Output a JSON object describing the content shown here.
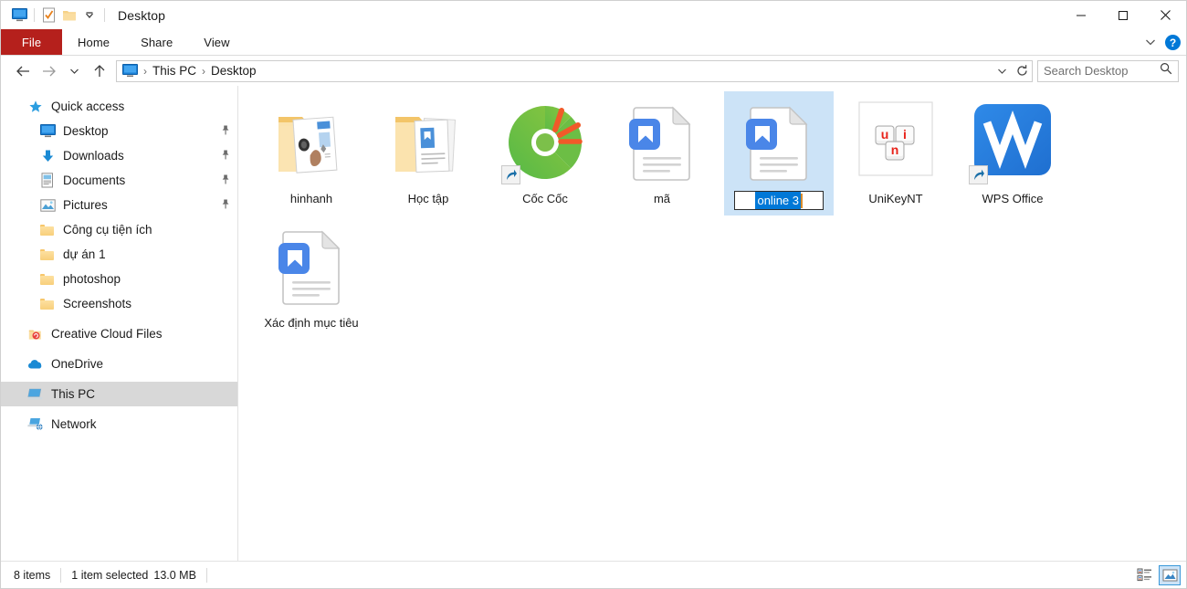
{
  "window": {
    "title": "Desktop",
    "quick_access_toolbar": [
      {
        "name": "explorer-icon",
        "icon": "monitor-icon"
      },
      {
        "name": "properties-icon",
        "icon": "checklist-icon"
      },
      {
        "name": "new-folder-icon",
        "icon": "folder-icon"
      },
      {
        "name": "customize-qat",
        "icon": "chevron-down-icon"
      }
    ],
    "caption": {
      "minimize": "–",
      "maximize": "☐",
      "close": "✕"
    }
  },
  "ribbon": {
    "file_tab": "File",
    "tabs": [
      "Home",
      "Share",
      "View"
    ],
    "file_tab_color": "#b5201c",
    "expand_label": "⌄",
    "help_label": "?"
  },
  "addressbar": {
    "back": "←",
    "forward": "→",
    "recent": "⌄",
    "up": "↑",
    "breadcrumbs": [
      "This PC",
      "Desktop"
    ],
    "separator": "›",
    "dropdown": "⌄",
    "refresh": "↻"
  },
  "search": {
    "placeholder": "Search Desktop",
    "icon": "search-icon"
  },
  "sidebar": {
    "groups": [
      {
        "header": {
          "label": "Quick access",
          "icon": "star-icon",
          "indent": 0
        },
        "items": [
          {
            "label": "Desktop",
            "icon": "monitor-icon",
            "pinned": true,
            "indent": 1
          },
          {
            "label": "Downloads",
            "icon": "download-icon",
            "pinned": true,
            "indent": 1
          },
          {
            "label": "Documents",
            "icon": "document-icon",
            "pinned": true,
            "indent": 1
          },
          {
            "label": "Pictures",
            "icon": "pictures-icon",
            "pinned": true,
            "indent": 1
          },
          {
            "label": "Công cụ tiện ích",
            "icon": "folder-icon",
            "pinned": false,
            "indent": 1
          },
          {
            "label": "dự án 1",
            "icon": "folder-icon",
            "pinned": false,
            "indent": 1
          },
          {
            "label": "photoshop",
            "icon": "folder-icon",
            "pinned": false,
            "indent": 1
          },
          {
            "label": "Screenshots",
            "icon": "folder-icon",
            "pinned": false,
            "indent": 1
          }
        ]
      }
    ],
    "roots": [
      {
        "label": "Creative Cloud Files",
        "icon": "creative-cloud-icon",
        "selected": false
      },
      {
        "label": "OneDrive",
        "icon": "cloud-icon",
        "selected": false
      },
      {
        "label": "This PC",
        "icon": "this-pc-icon",
        "selected": true
      },
      {
        "label": "Network",
        "icon": "network-icon",
        "selected": false
      }
    ]
  },
  "files": [
    {
      "name": "hinhanh",
      "icon": "folder-thumbnail-images",
      "selected": false,
      "shortcut": false,
      "renaming": false
    },
    {
      "name": "Học tập",
      "icon": "folder-thumbnail-docs",
      "selected": false,
      "shortcut": false,
      "renaming": false
    },
    {
      "name": "Cốc Cốc",
      "icon": "coccoc-icon",
      "selected": false,
      "shortcut": true,
      "renaming": false
    },
    {
      "name": "mã",
      "icon": "wps-writer-doc-icon",
      "selected": false,
      "shortcut": false,
      "renaming": false
    },
    {
      "name": "online 3",
      "icon": "wps-writer-doc-icon",
      "selected": true,
      "shortcut": false,
      "renaming": true
    },
    {
      "name": "UniKeyNT",
      "icon": "unikey-icon",
      "selected": false,
      "shortcut": false,
      "renaming": false
    },
    {
      "name": "WPS Office",
      "icon": "wps-office-icon",
      "selected": false,
      "shortcut": true,
      "renaming": false
    },
    {
      "name": "Xác định mục tiêu",
      "icon": "wps-writer-doc-icon",
      "selected": false,
      "shortcut": false,
      "renaming": false
    }
  ],
  "rename_field": {
    "value": "online 3",
    "selected_text": "online 3",
    "selection_color": "#0078d7"
  },
  "statusbar": {
    "item_count": "8 items",
    "selection": "1 item selected",
    "size": "13.0 MB",
    "views": [
      {
        "name": "details-view-button",
        "active": false
      },
      {
        "name": "large-icons-view-button",
        "active": true
      }
    ]
  },
  "colors": {
    "accent": "#0078d7",
    "selection_bg": "#cce3f7",
    "file_tab": "#b5201c",
    "sidebar_selected": "#d8d8d8"
  }
}
